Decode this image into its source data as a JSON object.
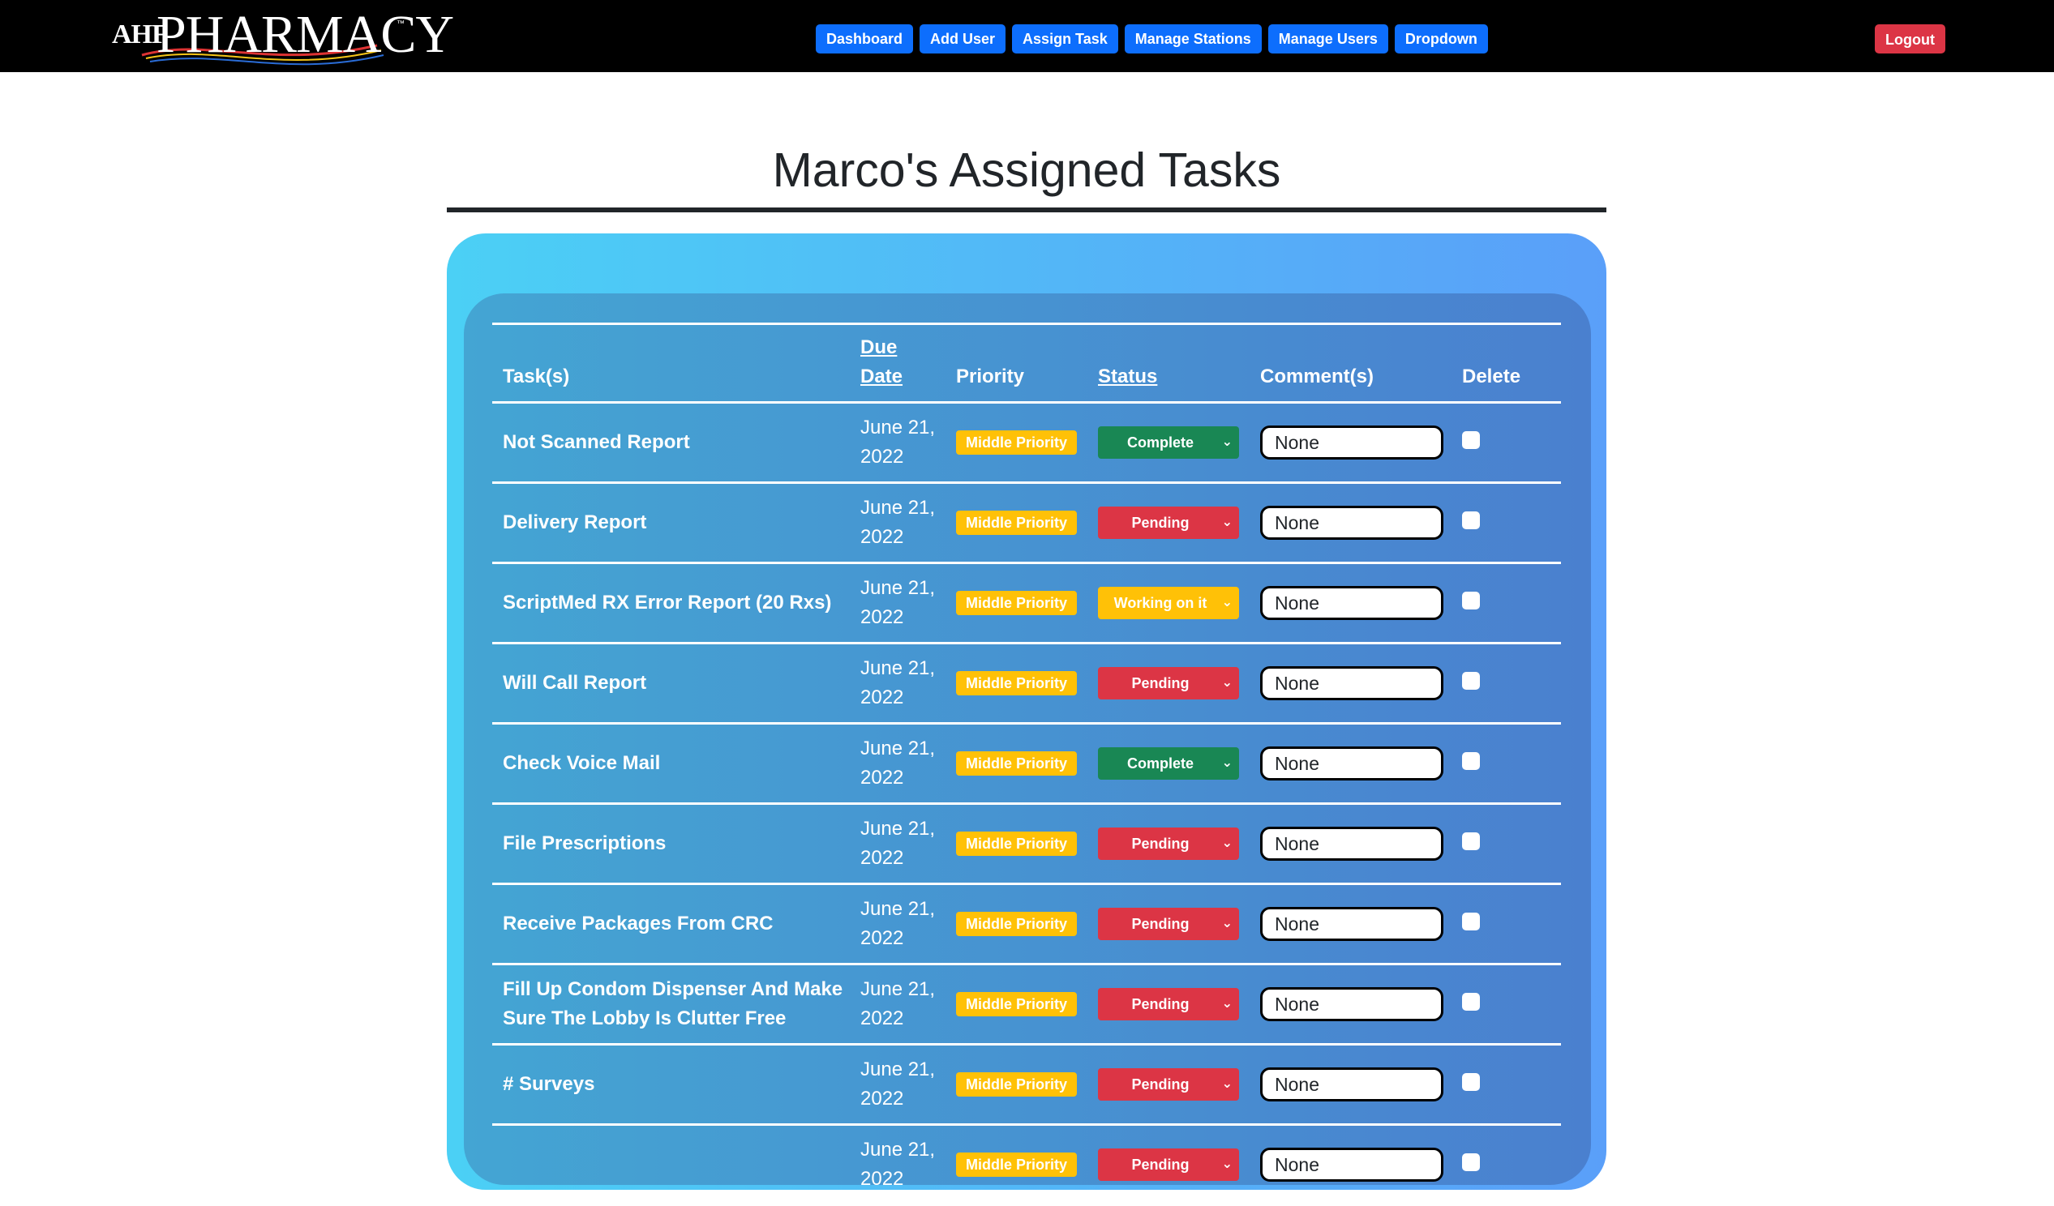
{
  "header": {
    "logo_prefix": "AHF",
    "logo_main": "PHARMACY",
    "logo_tm": "™",
    "nav": [
      "Dashboard",
      "Add User",
      "Assign Task",
      "Manage Stations",
      "Manage Users",
      "Dropdown"
    ],
    "logout": "Logout"
  },
  "page": {
    "title": "Marco's Assigned Tasks"
  },
  "table": {
    "headers": {
      "task": "Task(s)",
      "due_line1": "Due",
      "due_line2": "Date",
      "priority": "Priority",
      "status": "Status",
      "comments": "Comment(s)",
      "delete": "Delete"
    },
    "rows": [
      {
        "task": "Not Scanned Report",
        "due1": "June 21,",
        "due2": "2022",
        "priority": "Middle Priority",
        "status": "Complete",
        "comment": "None"
      },
      {
        "task": "Delivery Report",
        "due1": "June 21,",
        "due2": "2022",
        "priority": "Middle Priority",
        "status": "Pending",
        "comment": "None"
      },
      {
        "task": "ScriptMed RX Error Report (20 Rxs)",
        "due1": "June 21,",
        "due2": "2022",
        "priority": "Middle Priority",
        "status": "Working on it",
        "comment": "None"
      },
      {
        "task": "Will Call Report",
        "due1": "June 21,",
        "due2": "2022",
        "priority": "Middle Priority",
        "status": "Pending",
        "comment": "None"
      },
      {
        "task": "Check Voice Mail",
        "due1": "June 21,",
        "due2": "2022",
        "priority": "Middle Priority",
        "status": "Complete",
        "comment": "None"
      },
      {
        "task": "File Prescriptions",
        "due1": "June 21,",
        "due2": "2022",
        "priority": "Middle Priority",
        "status": "Pending",
        "comment": "None"
      },
      {
        "task": "Receive Packages From CRC",
        "due1": "June 21,",
        "due2": "2022",
        "priority": "Middle Priority",
        "status": "Pending",
        "comment": "None"
      },
      {
        "task": "Fill Up Condom Dispenser And Make Sure The Lobby Is Clutter Free",
        "due1": "June 21,",
        "due2": "2022",
        "priority": "Middle Priority",
        "status": "Pending",
        "comment": "None"
      },
      {
        "task": "# Surveys",
        "due1": "June 21,",
        "due2": "2022",
        "priority": "Middle Priority",
        "status": "Pending",
        "comment": "None"
      },
      {
        "task": "",
        "due1": "June 21,",
        "due2": "2022",
        "priority": "Middle Priority",
        "status": "Pending",
        "comment": "None"
      }
    ]
  },
  "colors": {
    "nav_button": "#0d6efd",
    "logout": "#dc3545",
    "priority_badge": "#ffc107",
    "status_complete": "#198754",
    "status_pending": "#dc3545",
    "status_working": "#ffc107"
  }
}
